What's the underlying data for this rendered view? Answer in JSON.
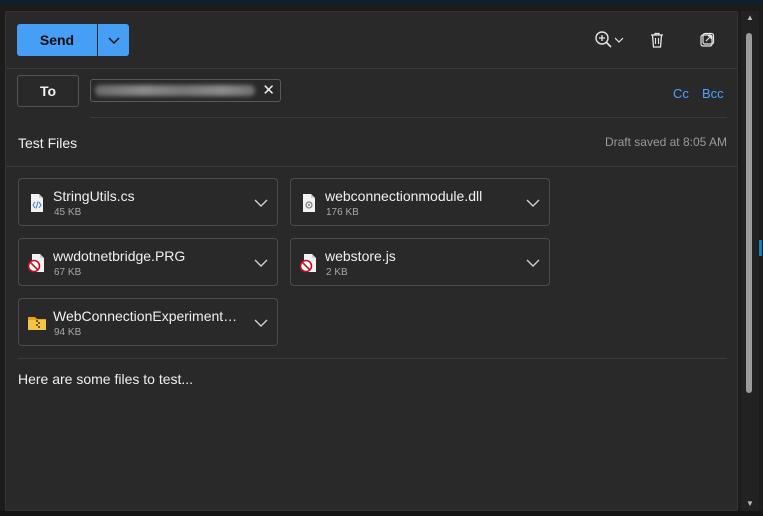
{
  "toolbar": {
    "send_label": "Send",
    "icons": [
      "zoom-in-icon",
      "chevron-down-icon",
      "delete-icon",
      "pop-out-icon"
    ]
  },
  "recipients": {
    "to_label": "To",
    "cc_label": "Cc",
    "bcc_label": "Bcc"
  },
  "subject": "Test Files",
  "draft_status": "Draft saved at 8:05 AM",
  "attachments": [
    {
      "name": "StringUtils.cs",
      "size": "45 KB",
      "icon": "code-file-icon"
    },
    {
      "name": "webconnectionmodule.dll",
      "size": "176 KB",
      "icon": "settings-file-icon"
    },
    {
      "name": "wwdotnetbridge.PRG",
      "size": "67 KB",
      "icon": "blocked-file-icon"
    },
    {
      "name": "webstore.js",
      "size": "2 KB",
      "icon": "blocked-file-icon"
    },
    {
      "name": "WebConnectionExperimental...",
      "size": "94 KB",
      "icon": "zip-folder-icon"
    }
  ],
  "body": "Here are some files to test...",
  "colors": {
    "accent": "#479ef5",
    "link": "#4aa3ff",
    "background": "#292929"
  }
}
